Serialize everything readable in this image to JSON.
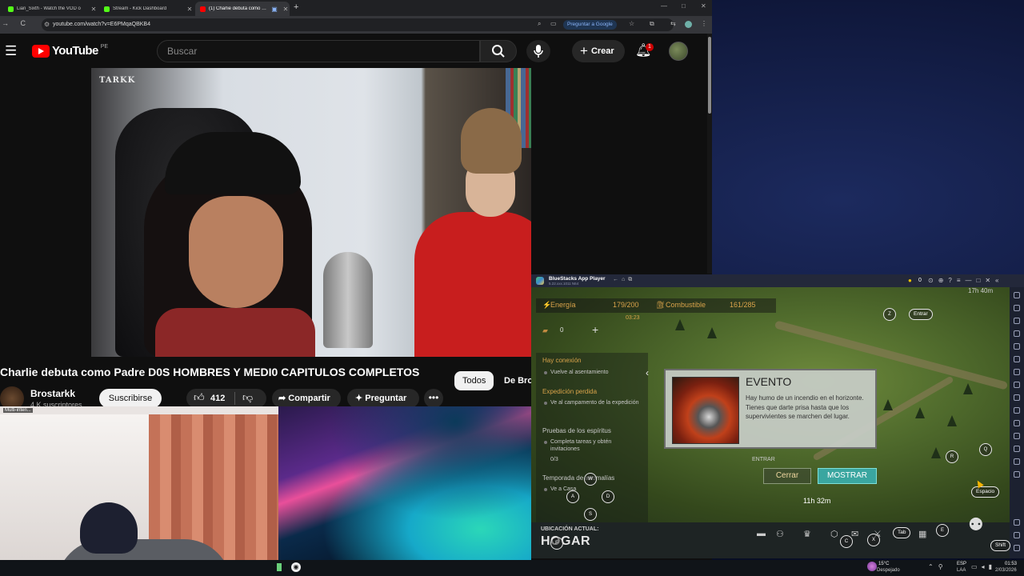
{
  "browser": {
    "tabs": [
      {
        "label": "Lian_Sixth - Watch the VOD o",
        "favicon_color": "#53fc18"
      },
      {
        "label": "Stream - Kick Dashboard",
        "favicon_color": "#53fc18"
      },
      {
        "label": "(1) Charlie debuta como Pa",
        "favicon_color": "#ff0000"
      }
    ],
    "new_tab": "+",
    "window_controls": [
      "—",
      "□",
      "✕"
    ],
    "url": "youtube.com/watch?v=E6PMqaQBKB4",
    "google_button": "Preguntar a Google"
  },
  "youtube": {
    "logo_text": "YouTube",
    "country_code": "PE",
    "search_placeholder": "Buscar",
    "create_label": "Crear",
    "notification_count": "1",
    "video_watermark": "TARKK",
    "video_title": "Charlie debuta como Padre D0S HOMBRES Y MEDI0 CAPITULOS COMPLETOS",
    "chips": [
      "Todos",
      "De Bro"
    ],
    "channel_name": "Brostarkk",
    "subscribers": "4 K suscriptores",
    "subscribe_label": "Suscribirse",
    "like_count": "412",
    "share_label": "Compartir",
    "ask_label": "Preguntar",
    "more_label": "•••"
  },
  "webcam": {
    "label": "Multi-interi..."
  },
  "bluestacks": {
    "app_name": "BlueStacks App Player",
    "version": "5.22.xxx.1011 N64",
    "coins": "0",
    "game": {
      "energy_label": "Energía",
      "energy_value": "179/200",
      "fuel_label": "Combustible",
      "fuel_value": "161/285",
      "stat_timer": "03:23",
      "resource_count": "0",
      "top_timer": "17h 40m",
      "quests": [
        {
          "title": "Hay conexión",
          "sub": "Vuelve al asentamiento"
        },
        {
          "title": "Expedición perdida",
          "sub": "Ve al campamento de la expedición"
        },
        {
          "title": "Pruebas de los espíritus",
          "sub": "Completa tareas y obtén invitaciones",
          "progress": "0/3"
        },
        {
          "title": "Temporada de anomalías",
          "sub": "Ve a Casa"
        }
      ],
      "keys": {
        "z": "Z",
        "enter": "Entrar",
        "q": "Q",
        "r": "R",
        "space": "Espacio",
        "w": "W",
        "a": "A",
        "s": "S",
        "d": "D",
        "tab": "Tab",
        "e": "E",
        "c": "C",
        "x": "X",
        "f": "F",
        "shift": "Shift"
      },
      "map_timer": "11h 32m",
      "event": {
        "title": "EVENTO",
        "body": "Hay humo de un incendio en el horizonte. Tienes que darte prisa hasta que los supervivientes se marchen del lugar.",
        "close_label": "Cerrar",
        "show_label": "MOSTRAR"
      },
      "hidden_label": "ENTRAR",
      "location_label": "UBICACIÓN ACTUAL:",
      "location_value": "HOGAR"
    }
  },
  "taskbar": {
    "weather_temp": "15°C",
    "weather_desc": "Despejado",
    "lang": "ESP",
    "lang_sub": "LAA",
    "time": "01:53",
    "date": "2/03/2026"
  }
}
